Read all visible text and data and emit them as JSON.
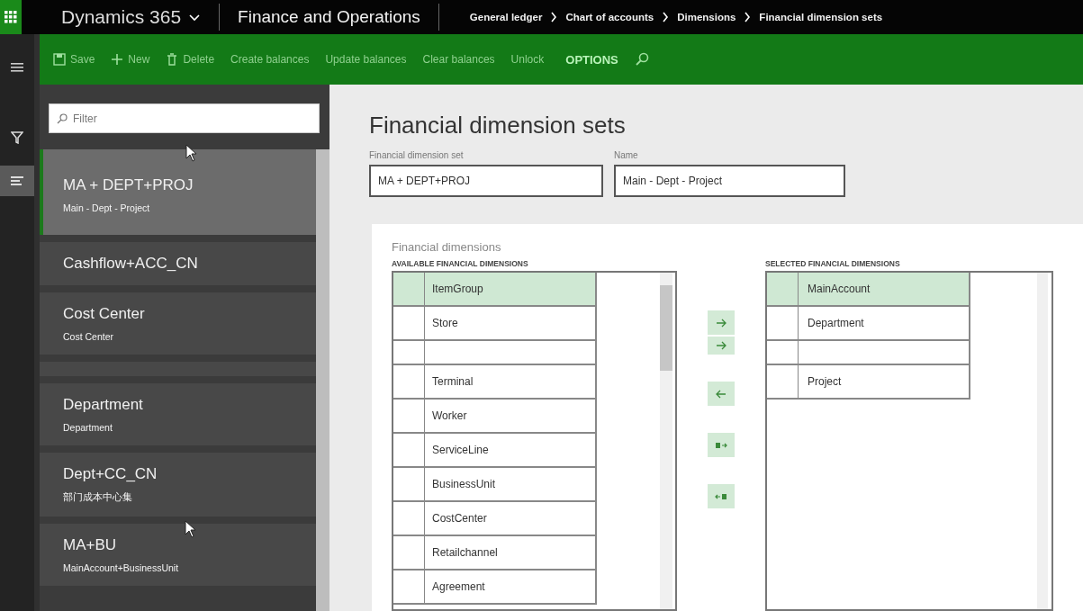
{
  "app_bar": {
    "app_name": "Dynamics 365",
    "product": "Finance and Operations",
    "breadcrumb": [
      "General ledger",
      "Chart of accounts",
      "Dimensions",
      "Financial dimension sets"
    ]
  },
  "action_bar": {
    "actions": [
      {
        "label": "Save",
        "kind": "save"
      },
      {
        "label": "New",
        "kind": "new"
      },
      {
        "label": "Delete",
        "kind": "delete"
      },
      {
        "label": "Create balances",
        "kind": "plain"
      },
      {
        "label": "Update balances",
        "kind": "plain"
      },
      {
        "label": "Clear balances",
        "kind": "plain"
      },
      {
        "label": "Unlock",
        "kind": "plain"
      },
      {
        "label": "OPTIONS",
        "kind": "menu"
      }
    ]
  },
  "filter_pane": {
    "placeholder": "Filter",
    "items": [
      {
        "title": "MA + DEPT+PROJ",
        "subtitle": "Main - Dept - Project",
        "selected": true
      },
      {
        "title": "Cashflow+ACC_CN",
        "selected": false
      },
      {
        "title": "Cost Center",
        "subtitle": "Cost Center",
        "selected": false
      },
      {
        "selected": false
      },
      {
        "title": "Department",
        "subtitle": "Department",
        "selected": false
      },
      {
        "title": "Dept+CC_CN",
        "subtitle": "部门成本中心集",
        "selected": false
      },
      {
        "title": "MA+BU",
        "subtitle": "MainAccount+BusinessUnit",
        "selected": false
      }
    ]
  },
  "form": {
    "title": "Financial dimension sets",
    "fields": [
      {
        "label": "Financial dimension set",
        "value": "MA + DEPT+PROJ"
      },
      {
        "label": "Name",
        "value": "Main - Dept - Project"
      }
    ],
    "section_title": "Financial dimensions",
    "available": {
      "header": "AVAILABLE FINANCIAL DIMENSIONS",
      "rows": [
        {
          "name": "ItemGroup",
          "selected": true
        },
        {
          "name": "Store",
          "selected": false
        },
        {
          "selected": false
        },
        {
          "name": "Terminal",
          "selected": false
        },
        {
          "name": "Worker",
          "selected": false
        },
        {
          "name": "ServiceLine",
          "selected": false
        },
        {
          "name": "BusinessUnit",
          "selected": false
        },
        {
          "name": "CostCenter",
          "selected": false
        },
        {
          "name": "Retailchannel",
          "selected": false
        },
        {
          "name": "Agreement",
          "selected": false
        }
      ]
    },
    "move_buttons": [
      {
        "kind": "add"
      },
      {
        "kind": "add"
      },
      {
        "kind": "remove"
      },
      {
        "kind": "add_all"
      },
      {
        "kind": "remove_all"
      }
    ],
    "selected": {
      "header": "SELECTED FINANCIAL DIMENSIONS",
      "rows": [
        {
          "name": "MainAccount",
          "selected": true
        },
        {
          "name": "Department",
          "selected": false
        },
        {
          "selected": false
        },
        {
          "name": "Project",
          "selected": false
        }
      ]
    }
  }
}
